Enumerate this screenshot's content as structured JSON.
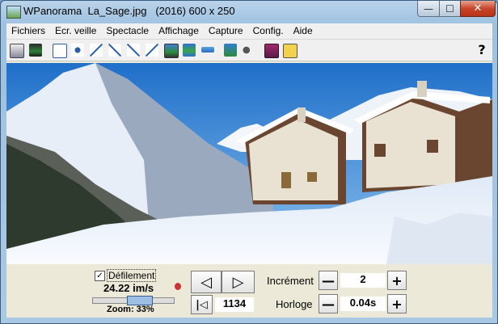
{
  "window": {
    "title": "WPanorama  La_Sage.jpg   (2016) 600 x 250",
    "minimize_glyph": "—",
    "maximize_glyph": "☐",
    "close_glyph": "✕"
  },
  "menu": [
    {
      "label": "Fichiers"
    },
    {
      "label": "Ecr. veille"
    },
    {
      "label": "Spectacle"
    },
    {
      "label": "Affichage"
    },
    {
      "label": "Capture"
    },
    {
      "label": "Config."
    },
    {
      "label": "Aide"
    }
  ],
  "toolbar": {
    "help_label": "?",
    "icons": [
      "open-icon",
      "image-icon",
      "fit-icon",
      "move-icon",
      "shrink-icon",
      "expand-icon",
      "shrink-diag-icon",
      "expand-diag-icon",
      "panorama-icon",
      "landscape-icon",
      "strip-icon",
      "tree-icon",
      "sound-icon",
      "book-icon",
      "help-question-icon"
    ]
  },
  "controls": {
    "scroll_checked": true,
    "scroll_check_glyph": "✓",
    "scroll_label": "Défilement",
    "speed": "24.22 im/s",
    "zoom_label": "Zoom: 33%",
    "zoom_percent": 33,
    "prev_glyph": "◁",
    "next_glyph": "▷",
    "first_glyph": "|◁",
    "frame_value": "1134",
    "increment_label": "Incrément",
    "increment_value": "2",
    "clock_label": "Horloge",
    "clock_value": "0.04s",
    "minus_glyph": "—",
    "plus_glyph": "+"
  },
  "colors": {
    "sky": "#3f88d6",
    "snow": "#f4f7fb",
    "chalet_wood": "#6a4630",
    "title_close": "#c8452b"
  }
}
